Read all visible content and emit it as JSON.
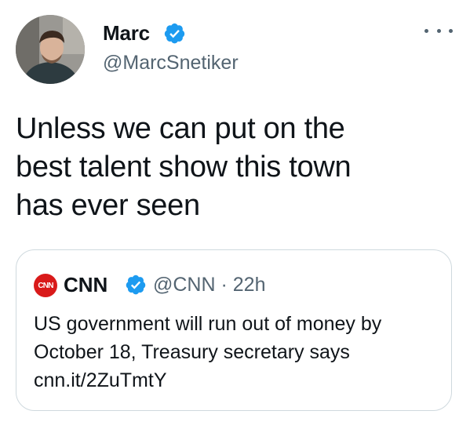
{
  "author": {
    "display_name": "Marc",
    "handle": "@MarcSnetiker",
    "verified_icon": "verified-badge-icon"
  },
  "tweet": {
    "text": "Unless we can put on the\nbest talent show this town\nhas ever seen"
  },
  "quoted_tweet": {
    "logo_text": "CNN",
    "display_name": "CNN",
    "handle": "@CNN",
    "separator": "·",
    "time": "22h",
    "text": "US government will run out of money by\nOctober 18, Treasury secretary says\ncnn.it/2ZuTmtY"
  },
  "colors": {
    "text": "#0f1419",
    "secondary": "#536471",
    "verified": "#1d9bf0",
    "border": "#cfd9de",
    "cnn_red": "#d91a1a"
  }
}
